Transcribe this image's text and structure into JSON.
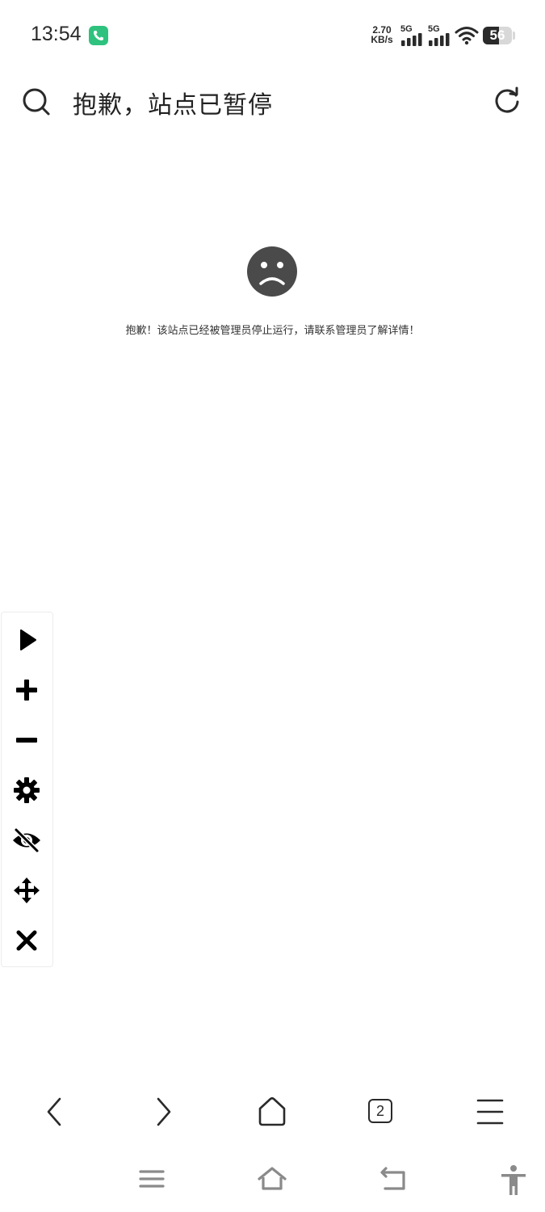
{
  "status_bar": {
    "time": "13:54",
    "net_speed_value": "2.70",
    "net_speed_unit": "KB/s",
    "sim1_label": "5G",
    "sim2_label": "5G",
    "battery_level": "56"
  },
  "address_bar": {
    "title": "抱歉，站点已暂停"
  },
  "content": {
    "error_message": "抱歉！该站点已经被管理员停止运行，请联系管理员了解详情！"
  },
  "tabs": {
    "count": "2"
  },
  "icons": {
    "call": "phone-call-icon",
    "search": "search-icon",
    "reload": "reload-icon",
    "sad_face": "sad-face-icon",
    "play": "play-icon",
    "zoom_in": "plus-icon",
    "zoom_out": "minus-icon",
    "settings": "gear-icon",
    "hide": "eye-slash-icon",
    "move": "move-arrows-icon",
    "close": "close-icon",
    "back": "chevron-left-icon",
    "forward": "chevron-right-icon",
    "home": "home-icon",
    "menu": "hamburger-menu-icon",
    "sys_recents": "recents-icon",
    "sys_home": "system-home-icon",
    "sys_back": "system-back-icon",
    "accessibility": "accessibility-icon"
  },
  "colors": {
    "call_badge": "#2ec27e",
    "icon_dark": "#2a2a2a",
    "sad_face": "#4a4a4a",
    "system_nav": "#8a8a8a"
  }
}
